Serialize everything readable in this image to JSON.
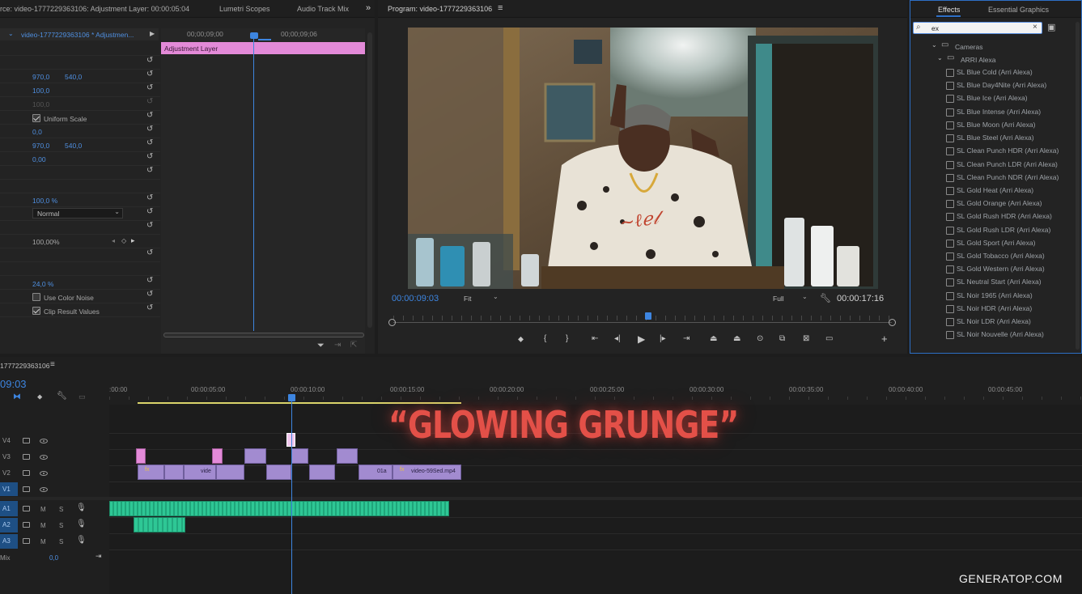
{
  "source_panel": {
    "tabs": [
      "rce: video-1777229363106: Adjustment Layer: 00:00:05:04",
      "Lumetri Scopes",
      "Audio Track Mix"
    ],
    "clip_header": "video-1777229363106 * Adjustmen...",
    "times": [
      "00;00;09;00",
      "00;00;09;06"
    ],
    "adjustment_layer_label": "Adjustment Layer",
    "values": {
      "pos_x": "970,0",
      "pos_y": "540,0",
      "scale": "100,0",
      "scale_w": "100,0",
      "uniform_scale": "Uniform Scale",
      "rotation": "0,0",
      "anchor_x": "970,0",
      "anchor_y": "540,0",
      "anti_flicker": "0,00",
      "opacity": "100,0 %",
      "blend_mode": "Normal",
      "percent": "100,00%",
      "amount": "24,0 %",
      "use_color_noise": "Use Color Noise",
      "clip_result": "Clip Result Values"
    }
  },
  "program": {
    "title": "Program: video-1777229363106",
    "timecode": "00:00:09:03",
    "fit": "Fit",
    "quality": "Full",
    "duration": "00:00:17:16"
  },
  "effects": {
    "tabs": [
      "Effects",
      "Essential Graphics"
    ],
    "search_value": "ex",
    "folder": "Cameras",
    "subfolder": "ARRI Alexa",
    "items": [
      "SL Blue Cold (Arri Alexa)",
      "SL Blue Day4Nite (Arri Alexa)",
      "SL Blue Ice (Arri Alexa)",
      "SL Blue Intense (Arri Alexa)",
      "SL Blue Moon (Arri Alexa)",
      "SL Blue Steel (Arri Alexa)",
      "SL Clean Punch HDR (Arri Alexa)",
      "SL Clean Punch LDR (Arri Alexa)",
      "SL Clean Punch NDR (Arri Alexa)",
      "SL Gold Heat (Arri Alexa)",
      "SL Gold Orange (Arri Alexa)",
      "SL Gold Rush HDR (Arri Alexa)",
      "SL Gold Rush LDR (Arri Alexa)",
      "SL Gold Sport (Arri Alexa)",
      "SL Gold Tobacco (Arri Alexa)",
      "SL Gold Western (Arri Alexa)",
      "SL Neutral Start (Arri Alexa)",
      "SL Noir 1965 (Arri Alexa)",
      "SL Noir HDR (Arri Alexa)",
      "SL Noir LDR (Arri Alexa)",
      "SL Noir Nouvelle (Arri Alexa)"
    ]
  },
  "timeline": {
    "sequence_name": "1777229363106",
    "timecode": "09:03",
    "ruler": [
      ":00:00",
      "00:00:05:00",
      "00:00:10:00",
      "00:00:15:00",
      "00:00:20:00",
      "00:00:25:00",
      "00:00:30:00",
      "00:00:35:00",
      "00:00:40:00",
      "00:00:45:00"
    ],
    "tracks": [
      "V4",
      "V3",
      "V2",
      "V1",
      "A1",
      "A2",
      "A3"
    ],
    "mute_label": "M",
    "solo_label": "S",
    "mix_label": "Mix",
    "mix_value": "0,0",
    "clip_labels": [
      "vide",
      "01a",
      "video-59Sed.mp4"
    ]
  },
  "overlay": {
    "title": "“GLOWING GRUNGE”",
    "watermark": "GENERATOP.COM"
  }
}
